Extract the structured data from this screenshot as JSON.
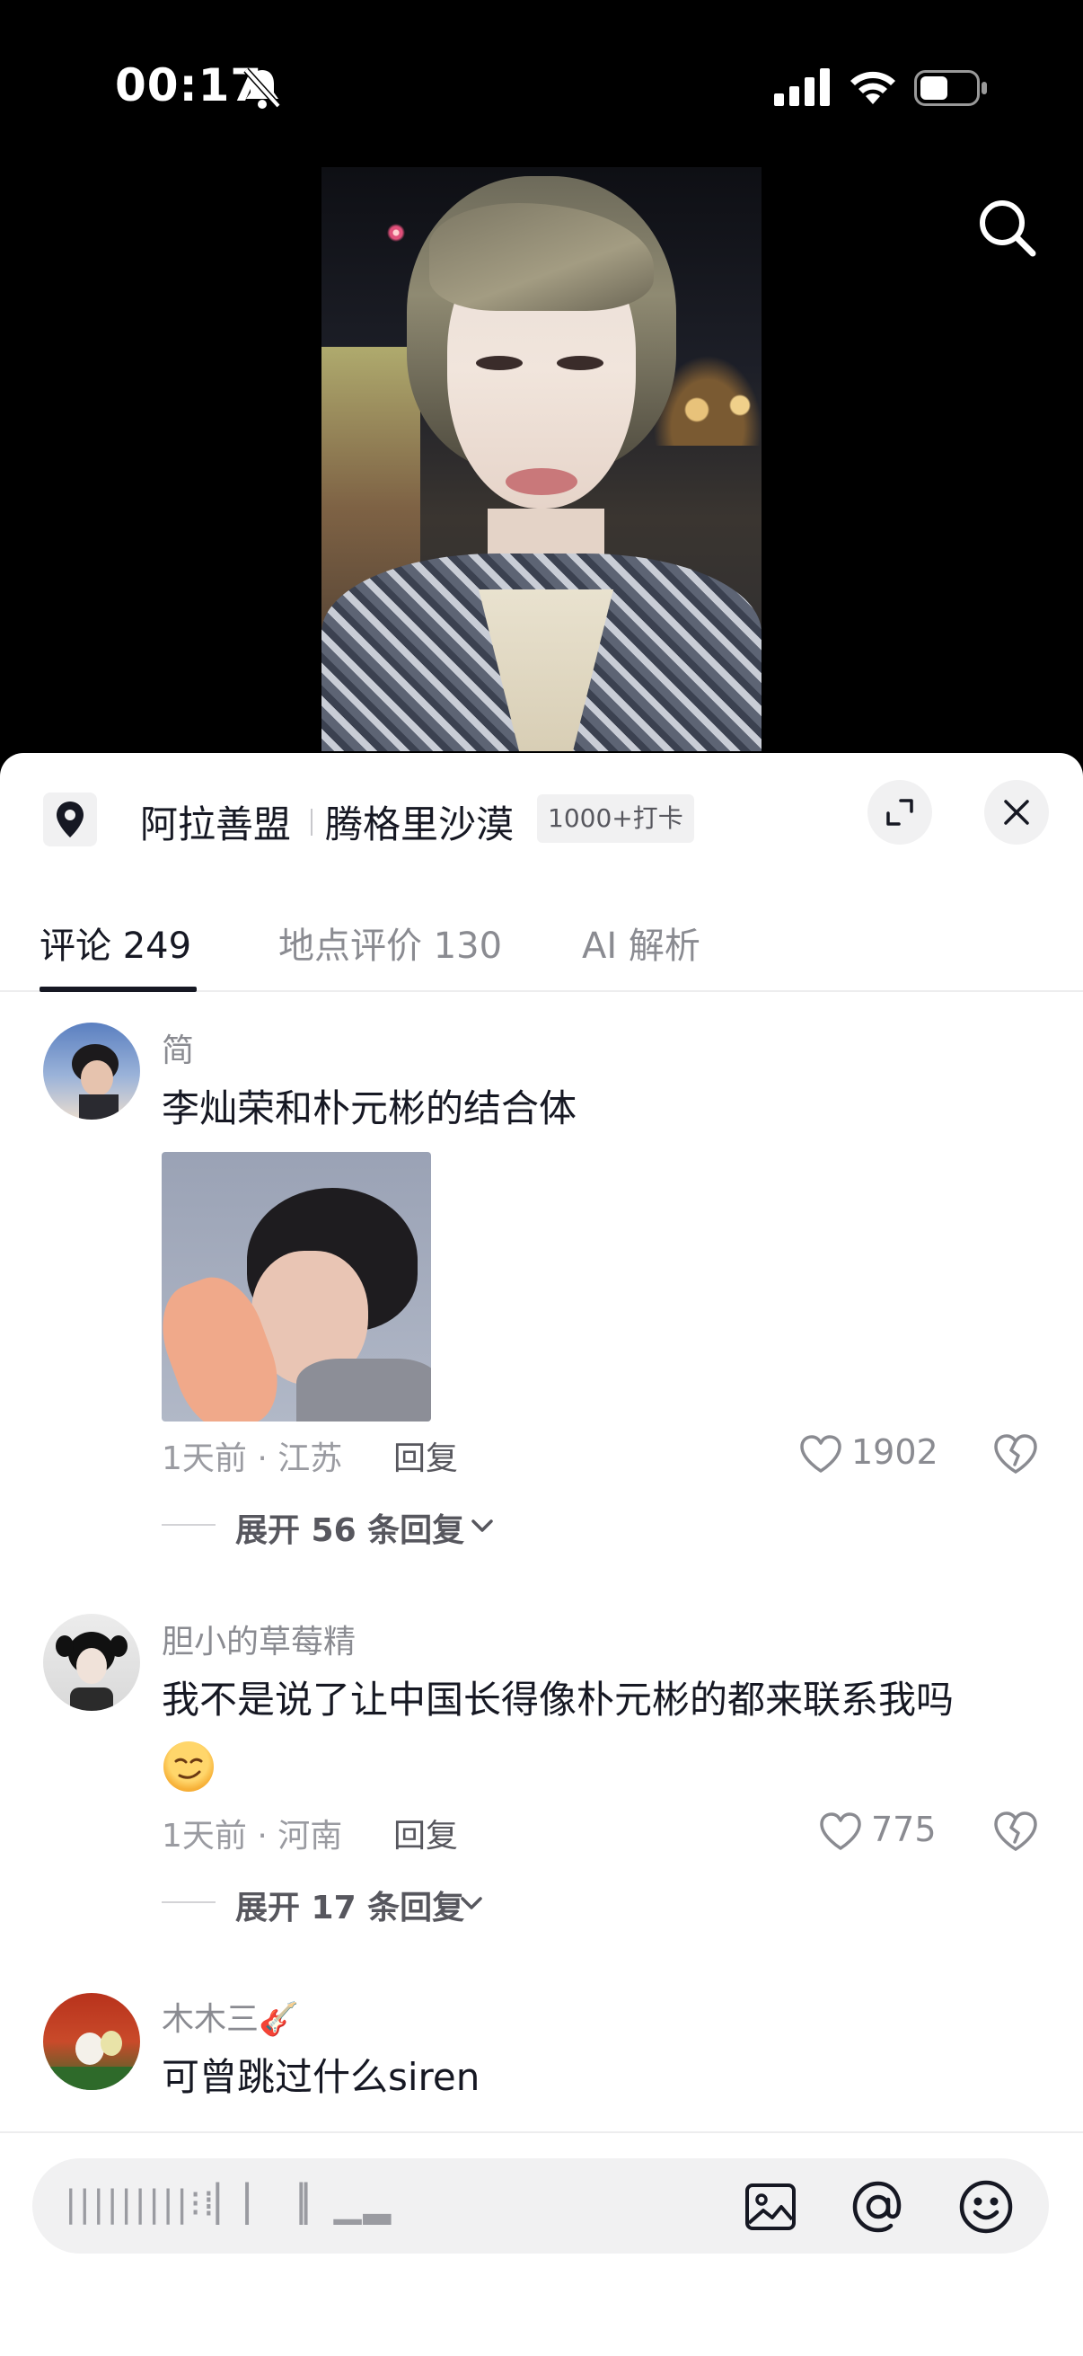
{
  "status_bar": {
    "time": "00:17"
  },
  "location": {
    "city": "阿拉善盟",
    "place": "腾格里沙漠",
    "badge": "1000+打卡"
  },
  "tabs": [
    {
      "label": "评论 249",
      "active": true
    },
    {
      "label": "地点评价 130",
      "active": false
    },
    {
      "label": "AI 解析",
      "active": false
    }
  ],
  "comments": [
    {
      "user": "简",
      "text": "李灿荣和朴元彬的结合体",
      "meta": "1天前 · 江苏",
      "reply_label": "回复",
      "likes": "1902",
      "expand_label": "展开 56 条回复",
      "has_image": true
    },
    {
      "user": "胆小的草莓精",
      "text": "我不是说了让中国长得像朴元彬的都来联系我吗",
      "meta": "1天前 · 河南",
      "reply_label": "回复",
      "likes": "775",
      "expand_label": "展开 17 条回复",
      "has_emoji": true
    },
    {
      "user": "木木三🎸",
      "text": "可曾跳过什么siren"
    }
  ],
  "input_bar": {
    "placeholder": "|||||||||⁝⁞▏▏▕▏▁▂"
  },
  "colors": {
    "text_primary": "#161823",
    "text_secondary": "#8a8b91",
    "surface": "#f1f1f2"
  }
}
